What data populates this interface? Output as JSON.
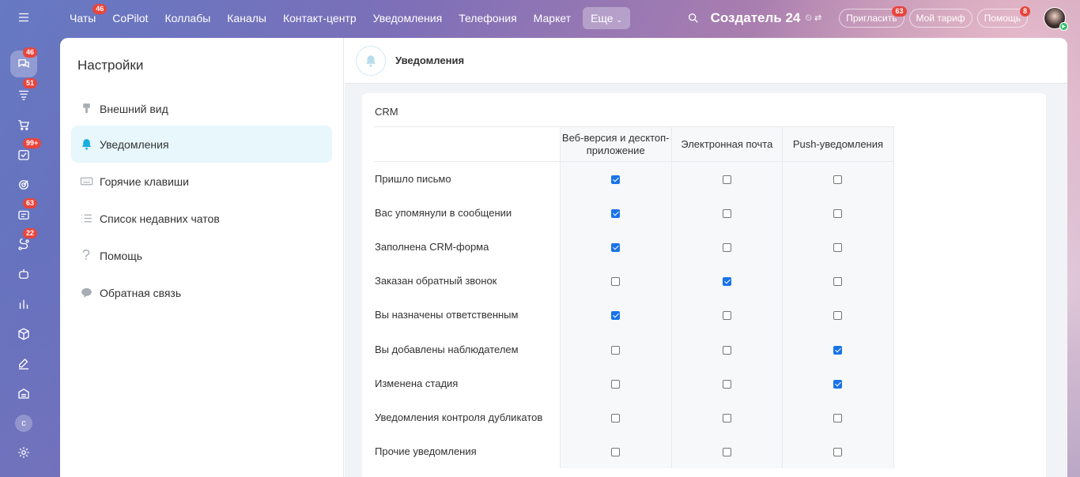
{
  "topbar": {
    "nav": [
      {
        "label": "Чаты",
        "badge": "46"
      },
      {
        "label": "CoPilot",
        "badge": ""
      },
      {
        "label": "Коллабы",
        "badge": ""
      },
      {
        "label": "Каналы",
        "badge": ""
      },
      {
        "label": "Контакт-центр",
        "badge": ""
      },
      {
        "label": "Уведомления",
        "badge": ""
      },
      {
        "label": "Телефония",
        "badge": ""
      },
      {
        "label": "Маркет",
        "badge": ""
      }
    ],
    "more_label": "Еще",
    "brand": "Создатель 24",
    "invite_label": "Пригласить",
    "invite_badge": "63",
    "tariff_label": "Мой тариф",
    "help_label": "Помощь",
    "help_badge": "8"
  },
  "rail": {
    "badges": [
      "46",
      "51",
      "",
      "99+",
      "",
      "63",
      "22"
    ],
    "avatar_letter": "c"
  },
  "settings": {
    "title": "Настройки",
    "items": [
      {
        "label": "Внешний вид",
        "icon": "paint-brush-icon"
      },
      {
        "label": "Уведомления",
        "icon": "bell-icon",
        "active": true
      },
      {
        "label": "Горячие клавиши",
        "icon": "keyboard-icon"
      },
      {
        "label": "Список недавних чатов",
        "icon": "list-icon"
      },
      {
        "label": "Помощь",
        "icon": "question-icon"
      },
      {
        "label": "Обратная связь",
        "icon": "chat-bubble-icon"
      }
    ]
  },
  "content": {
    "title": "Уведомления",
    "section": "CRM",
    "columns": [
      "Веб-версия и десктоп-приложение",
      "Электронная почта",
      "Push-уведомления"
    ],
    "rows": [
      {
        "label": "Пришло письмо",
        "values": [
          true,
          false,
          false
        ]
      },
      {
        "label": "Вас упомянули в сообщении",
        "values": [
          true,
          false,
          false
        ]
      },
      {
        "label": "Заполнена CRM-форма",
        "values": [
          true,
          false,
          false
        ]
      },
      {
        "label": "Заказан обратный звонок",
        "values": [
          false,
          true,
          false
        ]
      },
      {
        "label": "Вы назначены ответственным",
        "values": [
          true,
          false,
          false
        ]
      },
      {
        "label": "Вы добавлены наблюдателем",
        "values": [
          false,
          false,
          true
        ]
      },
      {
        "label": "Изменена стадия",
        "values": [
          false,
          false,
          true
        ]
      },
      {
        "label": "Уведомления контроля дубликатов",
        "values": [
          false,
          false,
          false
        ]
      },
      {
        "label": "Прочие уведомления",
        "values": [
          false,
          false,
          false
        ]
      }
    ]
  },
  "colors": {
    "accent": "#1a73e8",
    "active_menu_bg": "#e7f7fc",
    "badge": "#e8453c"
  }
}
